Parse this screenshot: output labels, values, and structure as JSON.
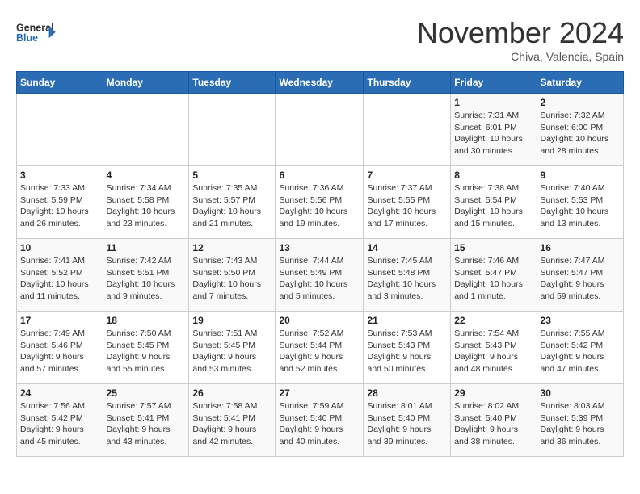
{
  "header": {
    "logo_general": "General",
    "logo_blue": "Blue",
    "month_title": "November 2024",
    "subtitle": "Chiva, Valencia, Spain"
  },
  "weekdays": [
    "Sunday",
    "Monday",
    "Tuesday",
    "Wednesday",
    "Thursday",
    "Friday",
    "Saturday"
  ],
  "weeks": [
    [
      {
        "day": "",
        "info": ""
      },
      {
        "day": "",
        "info": ""
      },
      {
        "day": "",
        "info": ""
      },
      {
        "day": "",
        "info": ""
      },
      {
        "day": "",
        "info": ""
      },
      {
        "day": "1",
        "info": "Sunrise: 7:31 AM\nSunset: 6:01 PM\nDaylight: 10 hours\nand 30 minutes."
      },
      {
        "day": "2",
        "info": "Sunrise: 7:32 AM\nSunset: 6:00 PM\nDaylight: 10 hours\nand 28 minutes."
      }
    ],
    [
      {
        "day": "3",
        "info": "Sunrise: 7:33 AM\nSunset: 5:59 PM\nDaylight: 10 hours\nand 26 minutes."
      },
      {
        "day": "4",
        "info": "Sunrise: 7:34 AM\nSunset: 5:58 PM\nDaylight: 10 hours\nand 23 minutes."
      },
      {
        "day": "5",
        "info": "Sunrise: 7:35 AM\nSunset: 5:57 PM\nDaylight: 10 hours\nand 21 minutes."
      },
      {
        "day": "6",
        "info": "Sunrise: 7:36 AM\nSunset: 5:56 PM\nDaylight: 10 hours\nand 19 minutes."
      },
      {
        "day": "7",
        "info": "Sunrise: 7:37 AM\nSunset: 5:55 PM\nDaylight: 10 hours\nand 17 minutes."
      },
      {
        "day": "8",
        "info": "Sunrise: 7:38 AM\nSunset: 5:54 PM\nDaylight: 10 hours\nand 15 minutes."
      },
      {
        "day": "9",
        "info": "Sunrise: 7:40 AM\nSunset: 5:53 PM\nDaylight: 10 hours\nand 13 minutes."
      }
    ],
    [
      {
        "day": "10",
        "info": "Sunrise: 7:41 AM\nSunset: 5:52 PM\nDaylight: 10 hours\nand 11 minutes."
      },
      {
        "day": "11",
        "info": "Sunrise: 7:42 AM\nSunset: 5:51 PM\nDaylight: 10 hours\nand 9 minutes."
      },
      {
        "day": "12",
        "info": "Sunrise: 7:43 AM\nSunset: 5:50 PM\nDaylight: 10 hours\nand 7 minutes."
      },
      {
        "day": "13",
        "info": "Sunrise: 7:44 AM\nSunset: 5:49 PM\nDaylight: 10 hours\nand 5 minutes."
      },
      {
        "day": "14",
        "info": "Sunrise: 7:45 AM\nSunset: 5:48 PM\nDaylight: 10 hours\nand 3 minutes."
      },
      {
        "day": "15",
        "info": "Sunrise: 7:46 AM\nSunset: 5:47 PM\nDaylight: 10 hours\nand 1 minute."
      },
      {
        "day": "16",
        "info": "Sunrise: 7:47 AM\nSunset: 5:47 PM\nDaylight: 9 hours\nand 59 minutes."
      }
    ],
    [
      {
        "day": "17",
        "info": "Sunrise: 7:49 AM\nSunset: 5:46 PM\nDaylight: 9 hours\nand 57 minutes."
      },
      {
        "day": "18",
        "info": "Sunrise: 7:50 AM\nSunset: 5:45 PM\nDaylight: 9 hours\nand 55 minutes."
      },
      {
        "day": "19",
        "info": "Sunrise: 7:51 AM\nSunset: 5:45 PM\nDaylight: 9 hours\nand 53 minutes."
      },
      {
        "day": "20",
        "info": "Sunrise: 7:52 AM\nSunset: 5:44 PM\nDaylight: 9 hours\nand 52 minutes."
      },
      {
        "day": "21",
        "info": "Sunrise: 7:53 AM\nSunset: 5:43 PM\nDaylight: 9 hours\nand 50 minutes."
      },
      {
        "day": "22",
        "info": "Sunrise: 7:54 AM\nSunset: 5:43 PM\nDaylight: 9 hours\nand 48 minutes."
      },
      {
        "day": "23",
        "info": "Sunrise: 7:55 AM\nSunset: 5:42 PM\nDaylight: 9 hours\nand 47 minutes."
      }
    ],
    [
      {
        "day": "24",
        "info": "Sunrise: 7:56 AM\nSunset: 5:42 PM\nDaylight: 9 hours\nand 45 minutes."
      },
      {
        "day": "25",
        "info": "Sunrise: 7:57 AM\nSunset: 5:41 PM\nDaylight: 9 hours\nand 43 minutes."
      },
      {
        "day": "26",
        "info": "Sunrise: 7:58 AM\nSunset: 5:41 PM\nDaylight: 9 hours\nand 42 minutes."
      },
      {
        "day": "27",
        "info": "Sunrise: 7:59 AM\nSunset: 5:40 PM\nDaylight: 9 hours\nand 40 minutes."
      },
      {
        "day": "28",
        "info": "Sunrise: 8:01 AM\nSunset: 5:40 PM\nDaylight: 9 hours\nand 39 minutes."
      },
      {
        "day": "29",
        "info": "Sunrise: 8:02 AM\nSunset: 5:40 PM\nDaylight: 9 hours\nand 38 minutes."
      },
      {
        "day": "30",
        "info": "Sunrise: 8:03 AM\nSunset: 5:39 PM\nDaylight: 9 hours\nand 36 minutes."
      }
    ]
  ]
}
